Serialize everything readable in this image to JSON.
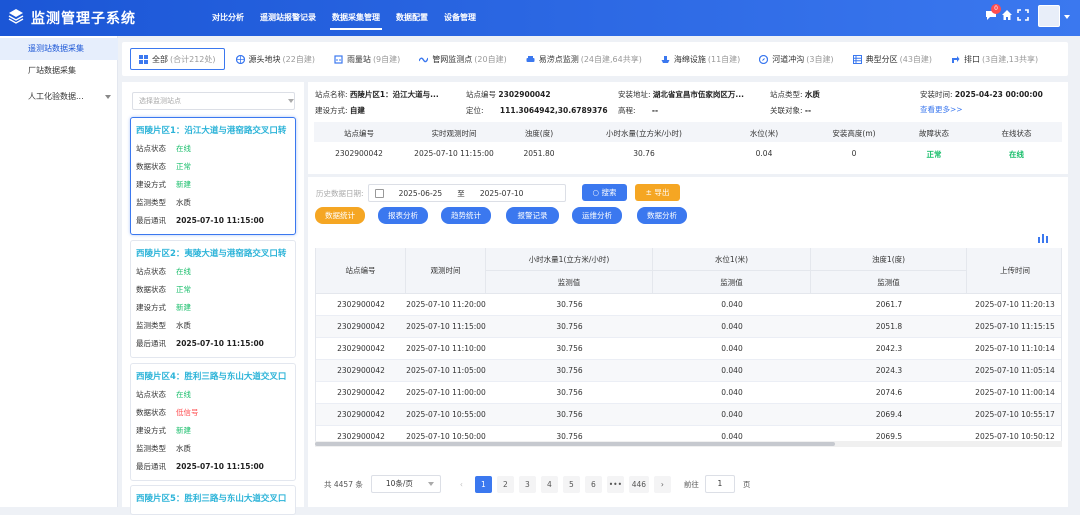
{
  "app": {
    "title": "监测管理子系统"
  },
  "nav": [
    "对比分析",
    "遥测站报警记录",
    "数据采集管理",
    "数据配置",
    "设备管理"
  ],
  "header": {
    "notice_count": "0"
  },
  "sidebar": [
    "遥测站数据采集",
    "厂站数据采集",
    "人工化验数据..."
  ],
  "filters": [
    {
      "label": "全部",
      "count": "(合计212处)"
    },
    {
      "label": "源头地块",
      "count": "(22自建)"
    },
    {
      "label": "雨量站",
      "count": "(9自建)"
    },
    {
      "label": "管网监测点",
      "count": "(20自建)"
    },
    {
      "label": "易涝点监测",
      "count": "(24自建,64共享)"
    },
    {
      "label": "海绵设施",
      "count": "(11自建)"
    },
    {
      "label": "河道冲沟",
      "count": "(3自建)"
    },
    {
      "label": "典型分区",
      "count": "(43自建)"
    },
    {
      "label": "排口",
      "count": "(3自建,13共享)"
    }
  ],
  "station_select": {
    "placeholder": "选择监测站点"
  },
  "labels": {
    "status": "站点状态",
    "data": "数据状态",
    "build": "建设方式",
    "type": "监测类型",
    "last": "最后通讯"
  },
  "stations": [
    {
      "name": "西陵片区1：沿江大道与港窑路交叉口转",
      "status": "在线",
      "data": "正常",
      "build": "新建",
      "type": "水质",
      "last": "2025-07-10 11:15:00"
    },
    {
      "name": "西陵片区2：夷陵大道与港窑路交叉口转",
      "status": "在线",
      "data": "正常",
      "build": "新建",
      "type": "水质",
      "last": "2025-07-10 11:15:00"
    },
    {
      "name": "西陵片区4：胜利三路与东山大道交叉口",
      "status": "在线",
      "data": "低信号",
      "build": "新建",
      "type": "水质",
      "last": "2025-07-10 11:15:00"
    },
    {
      "name": "西陵片区5：胜利三路与东山大道交叉口"
    }
  ],
  "info": {
    "name_k": "站点名称:",
    "name_v": "西陵片区1：沿江大道与...",
    "code_k": "站点编号",
    "code_v": "2302900042",
    "addr_k": "安装地址:",
    "addr_v": "湖北省宜昌市伍家岗区万...",
    "stype_k": "站点类型:",
    "stype_v": "水质",
    "itime_k": "安装时间:",
    "itime_v": "2025-04-23 00:00:00",
    "build_k": "建设方式:",
    "build_v": "自建",
    "pos_k": "定位:",
    "pos_v": "111.3064942,30.6789376",
    "elev_k": "高程:",
    "elev_v": "--",
    "rel_k": "关联对象:",
    "rel_v": "--",
    "more": "查看更多>>"
  },
  "realtime": {
    "headers": [
      "站点编号",
      "实时观测时间",
      "浊度(度)",
      "小时水量(立方米/小时)",
      "水位(米)",
      "安装高度(m)",
      "故障状态",
      "在线状态"
    ],
    "row": [
      "2302900042",
      "2025-07-10 11:15:00",
      "2051.80",
      "30.76",
      "0.04",
      "0",
      "正常",
      "在线"
    ]
  },
  "history": {
    "date_label": "历史数据日期:",
    "start": "2025-06-25",
    "sep": "至",
    "end": "2025-07-10",
    "search": "搜索",
    "export": "导出",
    "tabs": [
      "数据统计",
      "报表分析",
      "趋势统计",
      "报警记录",
      "运维分析",
      "数据分析"
    ]
  },
  "table": {
    "h_code": "站点编号",
    "h_time": "观测时间",
    "h_flow": "小时水量1(立方米/小时)",
    "h_level": "水位1(米)",
    "h_turb": "浊度1(度)",
    "h_sub": "监测值",
    "h_upload": "上传时间",
    "rows": [
      [
        "2302900042",
        "2025-07-10 11:20:00",
        "30.756",
        "0.040",
        "2061.7",
        "2025-07-10 11:20:13"
      ],
      [
        "2302900042",
        "2025-07-10 11:15:00",
        "30.756",
        "0.040",
        "2051.8",
        "2025-07-10 11:15:15"
      ],
      [
        "2302900042",
        "2025-07-10 11:10:00",
        "30.756",
        "0.040",
        "2042.3",
        "2025-07-10 11:10:14"
      ],
      [
        "2302900042",
        "2025-07-10 11:05:00",
        "30.756",
        "0.040",
        "2024.3",
        "2025-07-10 11:05:14"
      ],
      [
        "2302900042",
        "2025-07-10 11:00:00",
        "30.756",
        "0.040",
        "2074.6",
        "2025-07-10 11:00:14"
      ],
      [
        "2302900042",
        "2025-07-10 10:55:00",
        "30.756",
        "0.040",
        "2069.4",
        "2025-07-10 10:55:17"
      ],
      [
        "2302900042",
        "2025-07-10 10:50:00",
        "30.756",
        "0.040",
        "2069.5",
        "2025-07-10 10:50:12"
      ]
    ]
  },
  "pager": {
    "total": "共 4457 条",
    "size": "10条/页",
    "pages": [
      "1",
      "2",
      "3",
      "4",
      "5",
      "6",
      "•••",
      "446"
    ],
    "goto": "前往",
    "page": "1",
    "unit": "页"
  },
  "colors": {
    "primary": "#3b78ef",
    "header": "#1b56d6",
    "ok": "#19be6b",
    "warn": "#ff4d4f",
    "orange": "#f5a623"
  }
}
